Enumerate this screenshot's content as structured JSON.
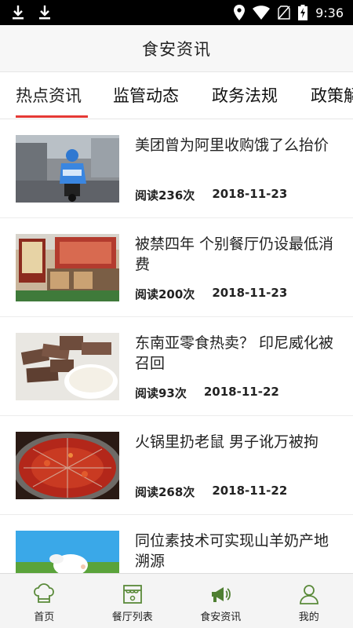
{
  "status_bar": {
    "time": "9:36",
    "icons": [
      "download-icon",
      "download-icon",
      "location-icon",
      "wifi-icon",
      "no-sim-icon",
      "battery-charging-icon"
    ]
  },
  "header": {
    "title": "食安资讯"
  },
  "tabs": [
    {
      "label": "热点资讯",
      "active": true
    },
    {
      "label": "监管动态",
      "active": false
    },
    {
      "label": "政务法规",
      "active": false
    },
    {
      "label": "政策解读",
      "active": false
    }
  ],
  "news": [
    {
      "title": "美团曾为阿里收购饿了么抬价",
      "read": "阅读236次",
      "date": "2018-11-23",
      "image": "scooter-delivery-photo"
    },
    {
      "title": "被禁四年 个别餐厅仍设最低消费",
      "read": "阅读200次",
      "date": "2018-11-23",
      "image": "restaurant-front-photo"
    },
    {
      "title": "东南亚零食热卖？ 印尼威化被召回",
      "read": "阅读93次",
      "date": "2018-11-22",
      "image": "wafer-snack-photo"
    },
    {
      "title": "火锅里扔老鼠 男子讹万被拘",
      "read": "阅读268次",
      "date": "2018-11-22",
      "image": "hotpot-photo"
    },
    {
      "title": "同位素技术可实现山羊奶产地溯源",
      "read": "",
      "date": "",
      "image": "goat-photo"
    }
  ],
  "bottom_nav": [
    {
      "label": "首页",
      "icon": "chef-hat-icon",
      "active": false
    },
    {
      "label": "餐厅列表",
      "icon": "storefront-icon",
      "active": false
    },
    {
      "label": "食安资讯",
      "icon": "megaphone-icon",
      "active": true
    },
    {
      "label": "我的",
      "icon": "user-icon",
      "active": false
    }
  ],
  "colors": {
    "accent": "#e53935",
    "nav_icon": "#5a8a3a",
    "header_bg": "#f7f7f7"
  }
}
